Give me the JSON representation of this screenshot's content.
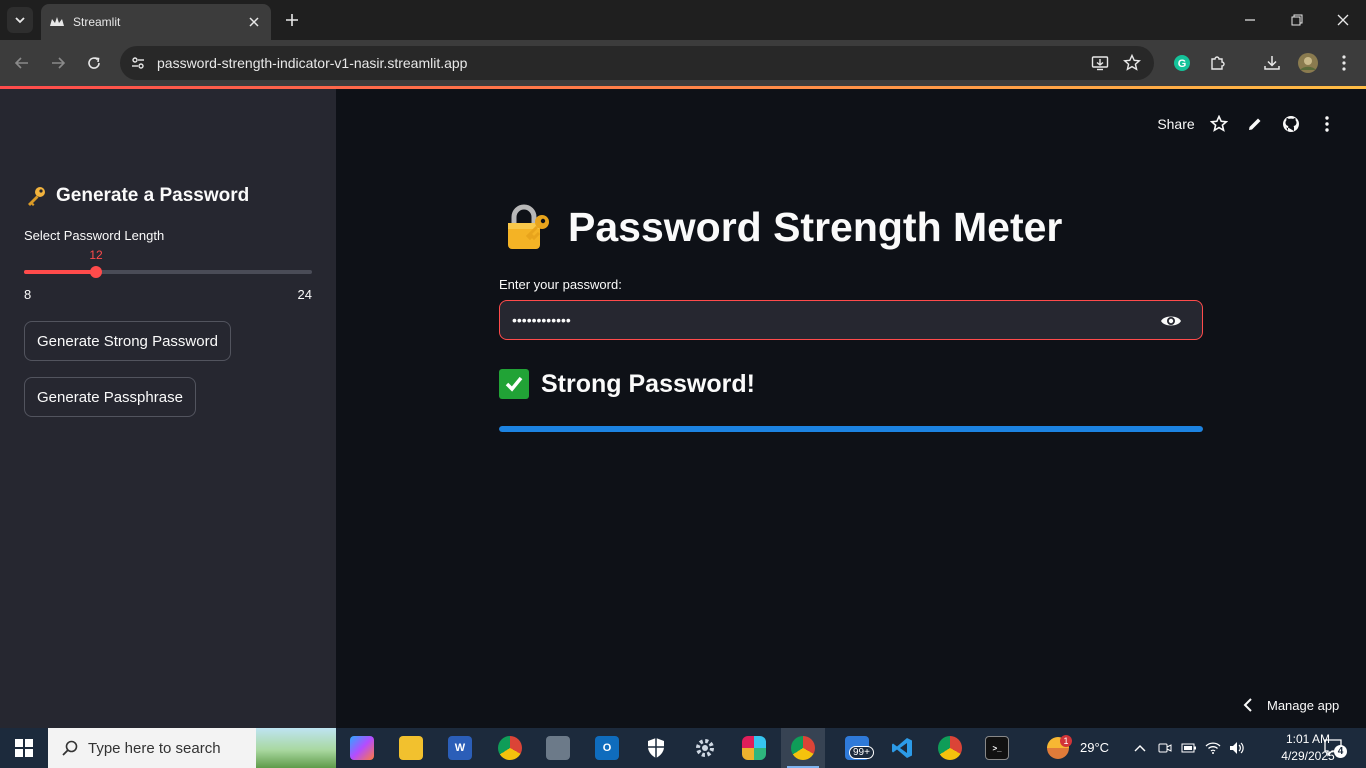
{
  "browser": {
    "tab_title": "Streamlit",
    "url": "password-strength-indicator-v1-nasir.streamlit.app"
  },
  "sidebar": {
    "heading": "Generate a Password",
    "slider": {
      "label": "Select Password Length",
      "value": "12",
      "min": "8",
      "max": "24",
      "fill_fraction": 0.25
    },
    "buttons": [
      {
        "label": "Generate Strong Password"
      },
      {
        "label": "Generate Passphrase"
      }
    ]
  },
  "toolbar": {
    "share_label": "Share"
  },
  "main": {
    "title": "Password Strength Meter",
    "input_label": "Enter your password:",
    "password_masked": "••••••••••••",
    "result_text": "Strong Password!",
    "progress_percent": 100,
    "manage_app_label": "Manage app"
  },
  "taskbar": {
    "search_placeholder": "Type here to search",
    "mail_badge": "99+",
    "weather_badge": "1",
    "temperature": "29°C",
    "time": "1:01 AM",
    "date": "4/29/2025",
    "notification_count": "4"
  },
  "colors": {
    "accent": "#ff4b4b",
    "progress": "#1c83e1",
    "success": "#21a336",
    "sidebar_bg": "#262730",
    "main_bg": "#0e1117"
  }
}
